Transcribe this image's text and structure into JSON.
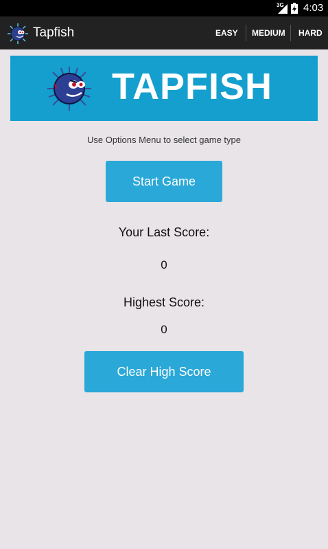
{
  "status_bar": {
    "network": "3G",
    "time": "4:03",
    "icons": [
      "signal-icon",
      "battery-icon"
    ]
  },
  "action_bar": {
    "title": "Tapfish",
    "icon": "tapfish-app-icon",
    "menu": [
      {
        "label": "EASY"
      },
      {
        "label": "MEDIUM"
      },
      {
        "label": "HARD"
      }
    ]
  },
  "banner": {
    "title": "TAPFISH",
    "logo": "pufferfish-logo",
    "background": "#149fce"
  },
  "main": {
    "hint": "Use Options Menu to select game type",
    "start_button": "Start Game",
    "last_score_label": "Your Last Score:",
    "last_score_value": "0",
    "high_score_label": "Highest Score:",
    "high_score_value": "0",
    "clear_button": "Clear High Score"
  },
  "colors": {
    "accent": "#2aa8d8",
    "action_bar": "#222222",
    "background": "#e8e4e8"
  }
}
